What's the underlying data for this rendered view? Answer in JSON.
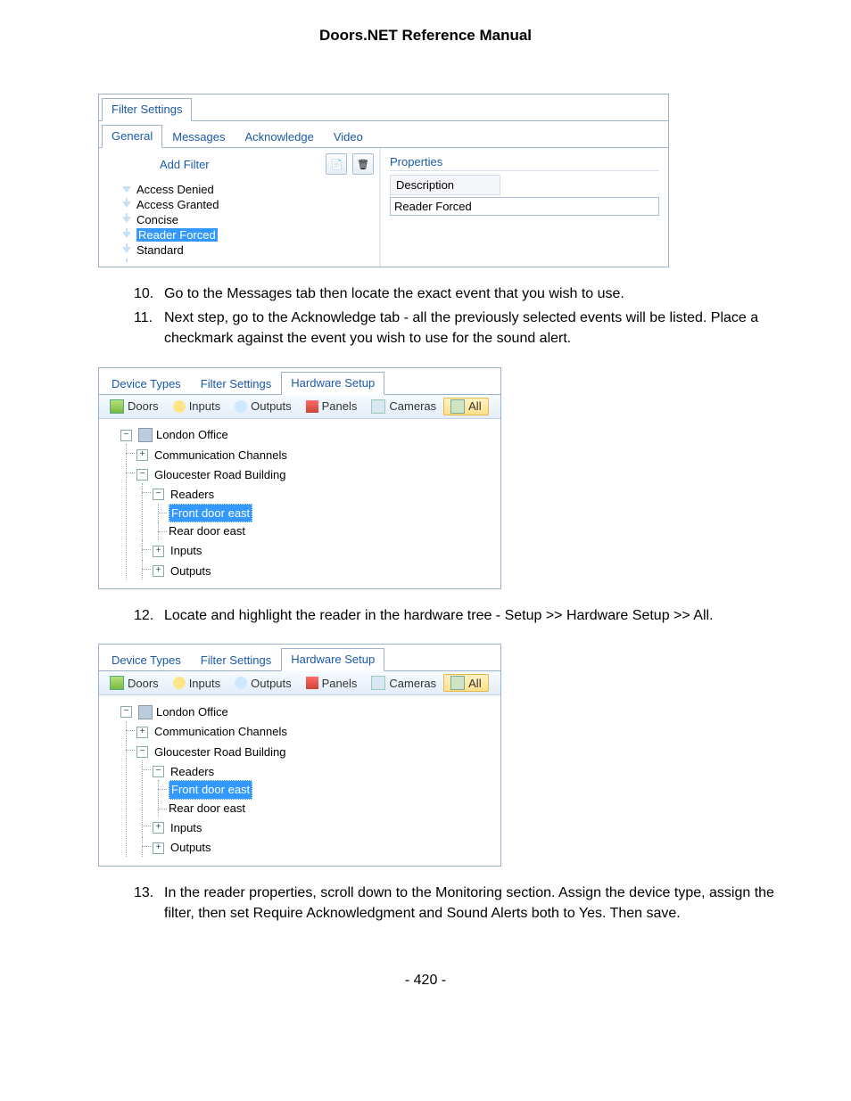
{
  "page_title": "Doors.NET Reference Manual",
  "page_number": "- 420 -",
  "panel1": {
    "window_tab": "Filter Settings",
    "tabs": [
      "General",
      "Messages",
      "Acknowledge",
      "Video"
    ],
    "active_tab": 0,
    "add_filter_label": "Add Filter",
    "filters": [
      "Access Denied",
      "Access Granted",
      "Concise",
      "Reader Forced",
      "Standard"
    ],
    "selected_filter": 3,
    "prop_header": "Properties",
    "prop_label": "Description",
    "prop_value": "Reader Forced"
  },
  "steps_a": [
    {
      "n": "10.",
      "t": "Go to the Messages tab then locate the exact event that you wish to use."
    },
    {
      "n": "11.",
      "t": "Next step, go to the Acknowledge tab - all the previously selected events will be listed. Place a checkmark against the event you wish to use for the sound alert."
    }
  ],
  "panel_hw": {
    "tabs": [
      "Device Types",
      "Filter Settings",
      "Hardware Setup"
    ],
    "active_tab": 2,
    "toolbar": [
      {
        "label": "Doors",
        "icon": "ico-door"
      },
      {
        "label": "Inputs",
        "icon": "ico-input"
      },
      {
        "label": "Outputs",
        "icon": "ico-output"
      },
      {
        "label": "Panels",
        "icon": "ico-panel"
      },
      {
        "label": "Cameras",
        "icon": "ico-cam"
      },
      {
        "label": "All",
        "icon": "ico-all",
        "selected": true
      }
    ],
    "tree": {
      "root": "London Office",
      "children": [
        {
          "label": "Communication Channels",
          "exp": "+"
        },
        {
          "label": "Gloucester Road Building",
          "exp": "-",
          "children": [
            {
              "label": "Readers",
              "exp": "-",
              "children": [
                {
                  "label": "Front door east",
                  "selected": true
                },
                {
                  "label": "Rear door east"
                }
              ]
            },
            {
              "label": "Inputs",
              "exp": "+"
            },
            {
              "label": "Outputs",
              "exp": "+"
            }
          ]
        }
      ]
    }
  },
  "steps_b": [
    {
      "n": "12.",
      "t": "Locate and highlight the reader in the hardware tree - Setup >> Hardware Setup >> All."
    }
  ],
  "steps_c": [
    {
      "n": "13.",
      "t": "In the reader properties, scroll down to the Monitoring section. Assign the device type, assign the filter, then set Require Acknowledgment and Sound Alerts both to Yes. Then save."
    }
  ]
}
